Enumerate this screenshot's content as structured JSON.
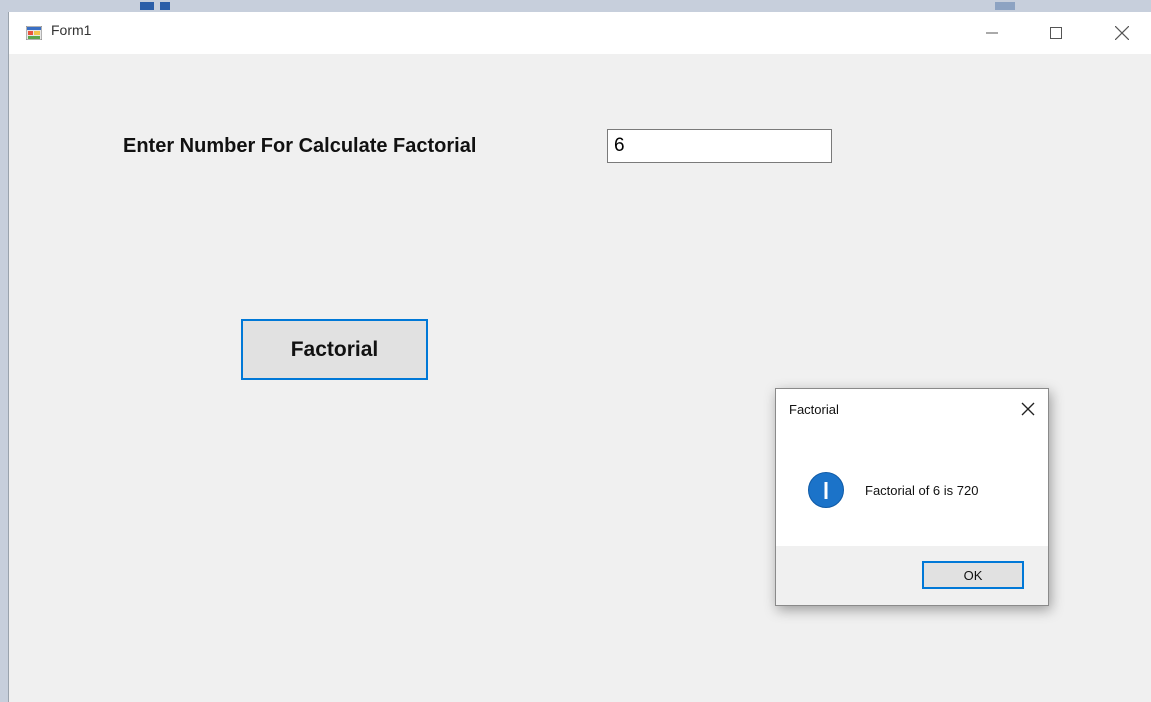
{
  "window": {
    "title": "Form1",
    "icon": "winforms-app-icon",
    "controls": {
      "minimize": "minimize-icon",
      "maximize": "maximize-icon",
      "close": "close-icon"
    }
  },
  "form": {
    "prompt_label": "Enter Number For Calculate Factorial",
    "number_input_value": "6",
    "factorial_button_label": "Factorial"
  },
  "dialog": {
    "title": "Factorial",
    "icon": "info-icon",
    "message": "Factorial of 6 is 720",
    "ok_label": "OK"
  },
  "colors": {
    "accent": "#0078d7",
    "info_icon": "#1b73c9",
    "form_background": "#f0f0f0"
  }
}
